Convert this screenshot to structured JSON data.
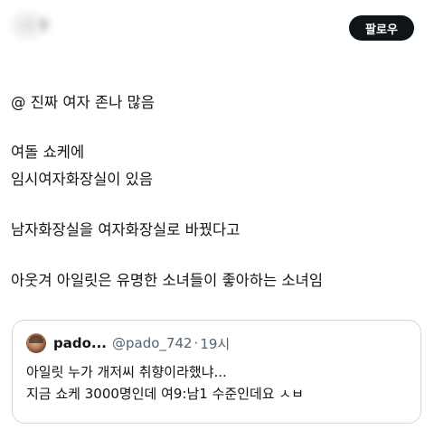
{
  "header": {
    "follow_label": "팔로우"
  },
  "post": {
    "lines": [
      "@ 진짜 여자 존나 많음",
      "여돌 쇼케에",
      "임시여자화장실이 있음",
      "남자화장실을 여자화장실로 바꿨다고",
      "아웃겨 아일릿은 유명한 소녀들이 좋아하는 소녀임"
    ]
  },
  "quote": {
    "name": "pado...",
    "handle": "@pado_742",
    "separator": "·",
    "time": "19시",
    "lines": [
      "아일릿 누가 개저씨 취향이라했냐...",
      "지금 쇼케 3000명인데 여9:남1 수준인데요 ㅅㅂ"
    ]
  }
}
